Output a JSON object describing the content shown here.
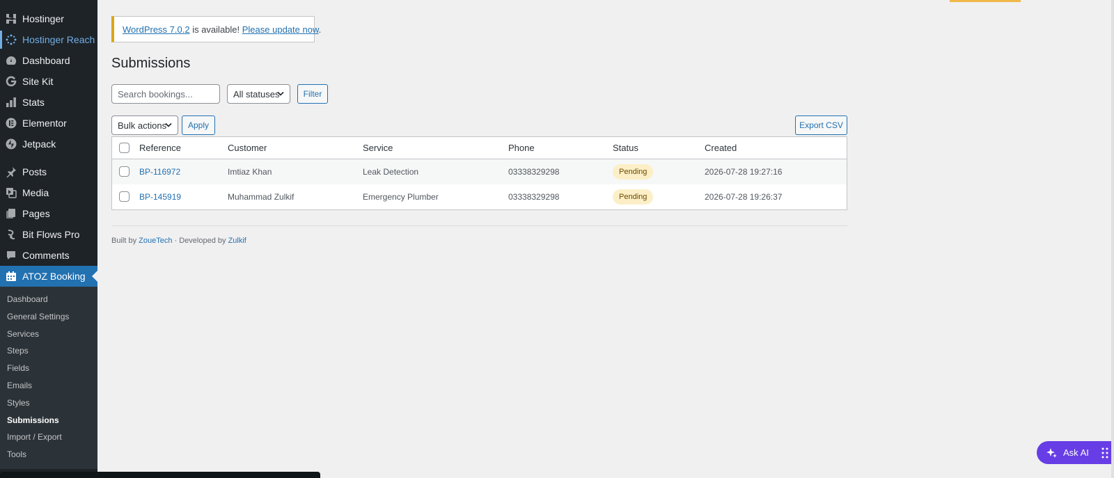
{
  "sidebar": {
    "top_items": [
      {
        "label": "Hostinger",
        "icon": "hostinger-logo-icon"
      },
      {
        "label": "Hostinger Reach",
        "icon": "reach-sparkle-icon"
      },
      {
        "label": "Dashboard",
        "icon": "dashboard-gauge-icon"
      },
      {
        "label": "Site Kit",
        "icon": "google-g-icon"
      },
      {
        "label": "Stats",
        "icon": "bar-chart-icon"
      },
      {
        "label": "Elementor",
        "icon": "elementor-icon"
      },
      {
        "label": "Jetpack",
        "icon": "jetpack-bolt-icon"
      }
    ],
    "content_items": [
      {
        "label": "Posts",
        "icon": "pushpin-icon"
      },
      {
        "label": "Media",
        "icon": "media-icon"
      },
      {
        "label": "Pages",
        "icon": "pages-icon"
      },
      {
        "label": "Bit Flows Pro",
        "icon": "bitflows-icon"
      },
      {
        "label": "Comments",
        "icon": "comment-bubble-icon"
      }
    ],
    "active_item": {
      "label": "ATOZ Booking",
      "icon": "calendar-icon"
    },
    "submenu": [
      "Dashboard",
      "General Settings",
      "Services",
      "Steps",
      "Fields",
      "Emails",
      "Styles",
      "Submissions",
      "Import / Export",
      "Tools"
    ],
    "current_submenu": "Submissions"
  },
  "notice": {
    "version_link": "WordPress 7.0.2",
    "middle_text": " is available! ",
    "update_link": "Please update now",
    "end_text": "."
  },
  "page_title": "Submissions",
  "filters": {
    "search_placeholder": "Search bookings...",
    "status_select": "All statuses",
    "filter_button": "Filter"
  },
  "bulk": {
    "select": "Bulk actions",
    "apply_button": "Apply",
    "export_button": "Export CSV"
  },
  "table": {
    "columns": [
      "Reference",
      "Customer",
      "Service",
      "Phone",
      "Status",
      "Created"
    ],
    "rows": [
      {
        "reference": "BP-116972",
        "customer": "Imtiaz Khan",
        "service": "Leak Detection",
        "phone": "03338329298",
        "status": "Pending",
        "created": "2026-07-28 19:27:16"
      },
      {
        "reference": "BP-145919",
        "customer": "Muhammad Zulkif",
        "service": "Emergency Plumber",
        "phone": "03338329298",
        "status": "Pending",
        "created": "2026-07-28 19:26:37"
      }
    ]
  },
  "footer": {
    "built_by_prefix": "Built by ",
    "built_by_link": "ZoueTech",
    "developed_prefix": " · Developed by ",
    "developer_link": "Zulkif"
  },
  "ask_ai": {
    "label": "Ask AI"
  },
  "colors": {
    "sidebar_bg": "#1d2327",
    "active_bg": "#2271b1",
    "link": "#2271b1",
    "pending_badge": "#fcefc7",
    "ask_ai": "#673de6",
    "notice_border": "#dba617"
  }
}
